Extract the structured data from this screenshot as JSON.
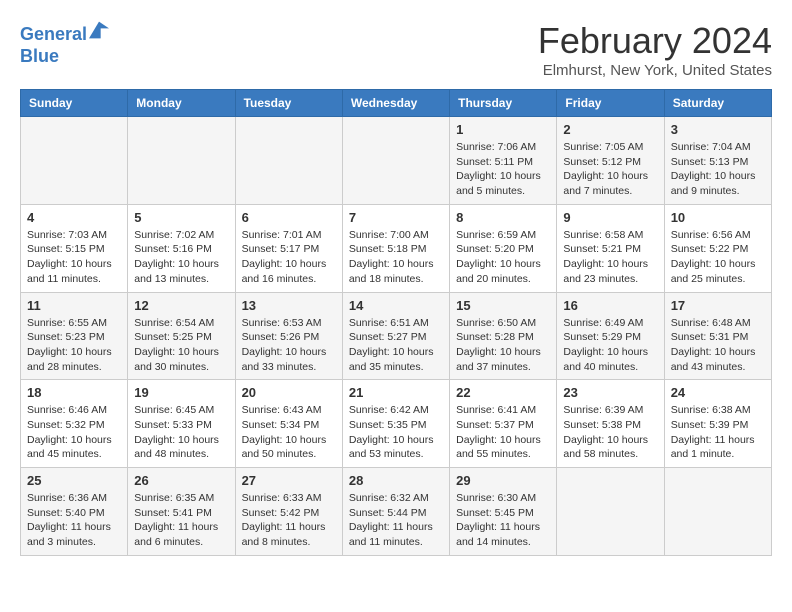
{
  "header": {
    "logo_line1": "General",
    "logo_line2": "Blue",
    "main_title": "February 2024",
    "subtitle": "Elmhurst, New York, United States"
  },
  "weekdays": [
    "Sunday",
    "Monday",
    "Tuesday",
    "Wednesday",
    "Thursday",
    "Friday",
    "Saturday"
  ],
  "weeks": [
    [
      {
        "day": "",
        "info": ""
      },
      {
        "day": "",
        "info": ""
      },
      {
        "day": "",
        "info": ""
      },
      {
        "day": "",
        "info": ""
      },
      {
        "day": "1",
        "info": "Sunrise: 7:06 AM\nSunset: 5:11 PM\nDaylight: 10 hours\nand 5 minutes."
      },
      {
        "day": "2",
        "info": "Sunrise: 7:05 AM\nSunset: 5:12 PM\nDaylight: 10 hours\nand 7 minutes."
      },
      {
        "day": "3",
        "info": "Sunrise: 7:04 AM\nSunset: 5:13 PM\nDaylight: 10 hours\nand 9 minutes."
      }
    ],
    [
      {
        "day": "4",
        "info": "Sunrise: 7:03 AM\nSunset: 5:15 PM\nDaylight: 10 hours\nand 11 minutes."
      },
      {
        "day": "5",
        "info": "Sunrise: 7:02 AM\nSunset: 5:16 PM\nDaylight: 10 hours\nand 13 minutes."
      },
      {
        "day": "6",
        "info": "Sunrise: 7:01 AM\nSunset: 5:17 PM\nDaylight: 10 hours\nand 16 minutes."
      },
      {
        "day": "7",
        "info": "Sunrise: 7:00 AM\nSunset: 5:18 PM\nDaylight: 10 hours\nand 18 minutes."
      },
      {
        "day": "8",
        "info": "Sunrise: 6:59 AM\nSunset: 5:20 PM\nDaylight: 10 hours\nand 20 minutes."
      },
      {
        "day": "9",
        "info": "Sunrise: 6:58 AM\nSunset: 5:21 PM\nDaylight: 10 hours\nand 23 minutes."
      },
      {
        "day": "10",
        "info": "Sunrise: 6:56 AM\nSunset: 5:22 PM\nDaylight: 10 hours\nand 25 minutes."
      }
    ],
    [
      {
        "day": "11",
        "info": "Sunrise: 6:55 AM\nSunset: 5:23 PM\nDaylight: 10 hours\nand 28 minutes."
      },
      {
        "day": "12",
        "info": "Sunrise: 6:54 AM\nSunset: 5:25 PM\nDaylight: 10 hours\nand 30 minutes."
      },
      {
        "day": "13",
        "info": "Sunrise: 6:53 AM\nSunset: 5:26 PM\nDaylight: 10 hours\nand 33 minutes."
      },
      {
        "day": "14",
        "info": "Sunrise: 6:51 AM\nSunset: 5:27 PM\nDaylight: 10 hours\nand 35 minutes."
      },
      {
        "day": "15",
        "info": "Sunrise: 6:50 AM\nSunset: 5:28 PM\nDaylight: 10 hours\nand 37 minutes."
      },
      {
        "day": "16",
        "info": "Sunrise: 6:49 AM\nSunset: 5:29 PM\nDaylight: 10 hours\nand 40 minutes."
      },
      {
        "day": "17",
        "info": "Sunrise: 6:48 AM\nSunset: 5:31 PM\nDaylight: 10 hours\nand 43 minutes."
      }
    ],
    [
      {
        "day": "18",
        "info": "Sunrise: 6:46 AM\nSunset: 5:32 PM\nDaylight: 10 hours\nand 45 minutes."
      },
      {
        "day": "19",
        "info": "Sunrise: 6:45 AM\nSunset: 5:33 PM\nDaylight: 10 hours\nand 48 minutes."
      },
      {
        "day": "20",
        "info": "Sunrise: 6:43 AM\nSunset: 5:34 PM\nDaylight: 10 hours\nand 50 minutes."
      },
      {
        "day": "21",
        "info": "Sunrise: 6:42 AM\nSunset: 5:35 PM\nDaylight: 10 hours\nand 53 minutes."
      },
      {
        "day": "22",
        "info": "Sunrise: 6:41 AM\nSunset: 5:37 PM\nDaylight: 10 hours\nand 55 minutes."
      },
      {
        "day": "23",
        "info": "Sunrise: 6:39 AM\nSunset: 5:38 PM\nDaylight: 10 hours\nand 58 minutes."
      },
      {
        "day": "24",
        "info": "Sunrise: 6:38 AM\nSunset: 5:39 PM\nDaylight: 11 hours\nand 1 minute."
      }
    ],
    [
      {
        "day": "25",
        "info": "Sunrise: 6:36 AM\nSunset: 5:40 PM\nDaylight: 11 hours\nand 3 minutes."
      },
      {
        "day": "26",
        "info": "Sunrise: 6:35 AM\nSunset: 5:41 PM\nDaylight: 11 hours\nand 6 minutes."
      },
      {
        "day": "27",
        "info": "Sunrise: 6:33 AM\nSunset: 5:42 PM\nDaylight: 11 hours\nand 8 minutes."
      },
      {
        "day": "28",
        "info": "Sunrise: 6:32 AM\nSunset: 5:44 PM\nDaylight: 11 hours\nand 11 minutes."
      },
      {
        "day": "29",
        "info": "Sunrise: 6:30 AM\nSunset: 5:45 PM\nDaylight: 11 hours\nand 14 minutes."
      },
      {
        "day": "",
        "info": ""
      },
      {
        "day": "",
        "info": ""
      }
    ]
  ]
}
